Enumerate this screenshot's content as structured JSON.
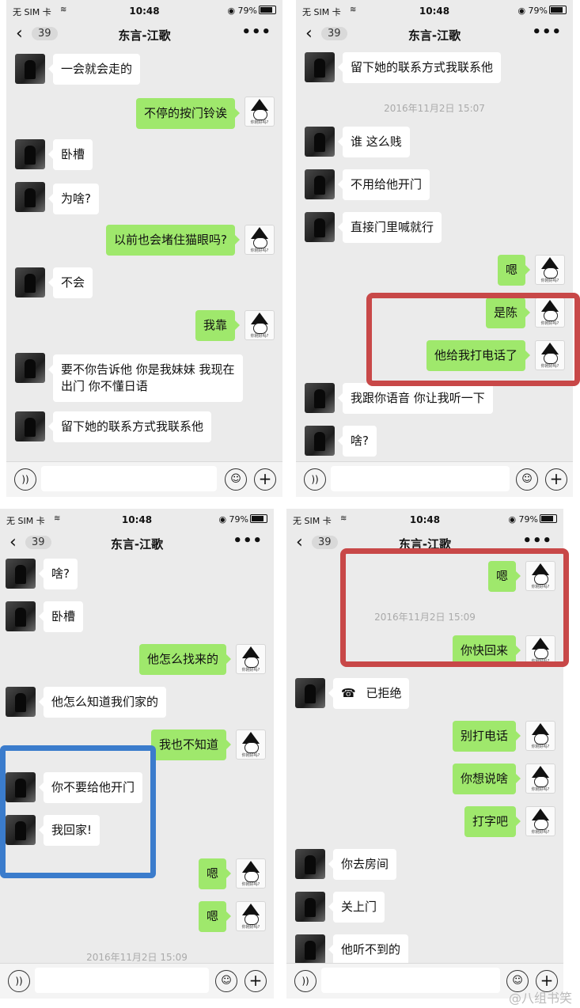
{
  "status": {
    "carrier": "无 SIM 卡",
    "time": "10:48",
    "battery": "79%"
  },
  "nav": {
    "back": "‹",
    "unread": "39",
    "title": "东言-江歌",
    "more": "•••"
  },
  "sticker": {
    "caption": "你刚好吗?"
  },
  "panel1": {
    "msgs": [
      {
        "text": "一会就会走的"
      },
      {
        "text": "不停的按门铃诶"
      },
      {
        "text": "卧槽"
      },
      {
        "text": "为啥?"
      },
      {
        "text": "以前也会堵住猫眼吗?"
      },
      {
        "text": "不会"
      },
      {
        "text": "我靠"
      },
      {
        "text": "要不你告诉他 你是我妹妹 我现在出门 你不懂日语"
      },
      {
        "text": "留下她的联系方式我联系他"
      }
    ]
  },
  "panel2": {
    "msgs": [
      {
        "text": "留下她的联系方式我联系他"
      },
      {
        "text": "谁 这么贱"
      },
      {
        "text": "不用给他开门"
      },
      {
        "text": "直接门里喊就行"
      },
      {
        "text": "嗯"
      },
      {
        "text": "是陈"
      },
      {
        "text": "他给我打电话了"
      },
      {
        "text": "我跟你语音 你让我听一下"
      },
      {
        "text": "啥?"
      }
    ],
    "timestamp": "2016年11月2日 15:07"
  },
  "panel3": {
    "msgs": [
      {
        "text": "啥?"
      },
      {
        "text": "卧槽"
      },
      {
        "text": "他怎么找来的"
      },
      {
        "text": "他怎么知道我们家的"
      },
      {
        "text": "我也不知道"
      },
      {
        "text": "你不要给他开门"
      },
      {
        "text": "我回家!"
      },
      {
        "text": "嗯"
      },
      {
        "text": "嗯"
      }
    ],
    "timestamp": "2016年11月2日 15:09"
  },
  "panel4": {
    "msgs": [
      {
        "text": "嗯"
      },
      {
        "text": "你快回来"
      },
      {
        "text": "已拒绝"
      },
      {
        "text": "别打电话"
      },
      {
        "text": "你想说啥"
      },
      {
        "text": "打字吧"
      },
      {
        "text": "你去房间"
      },
      {
        "text": "关上门"
      },
      {
        "text": "他听不到的"
      }
    ],
    "timestamp": "2016年11月2日 15:09",
    "call_icon": "☎"
  },
  "icons": {
    "voice": "voice-icon",
    "emoji": "emoji-icon",
    "plus": "plus-icon",
    "wifi": "wifi-icon",
    "battery": "battery-icon",
    "location": "location-icon"
  },
  "watermark": "@八组书笑",
  "colors": {
    "out_bubble": "#9fe86c",
    "in_bubble": "#ffffff",
    "chat_bg": "#ebebeb",
    "highlight_red": "#c84848",
    "highlight_blue": "#3b7ccc"
  }
}
